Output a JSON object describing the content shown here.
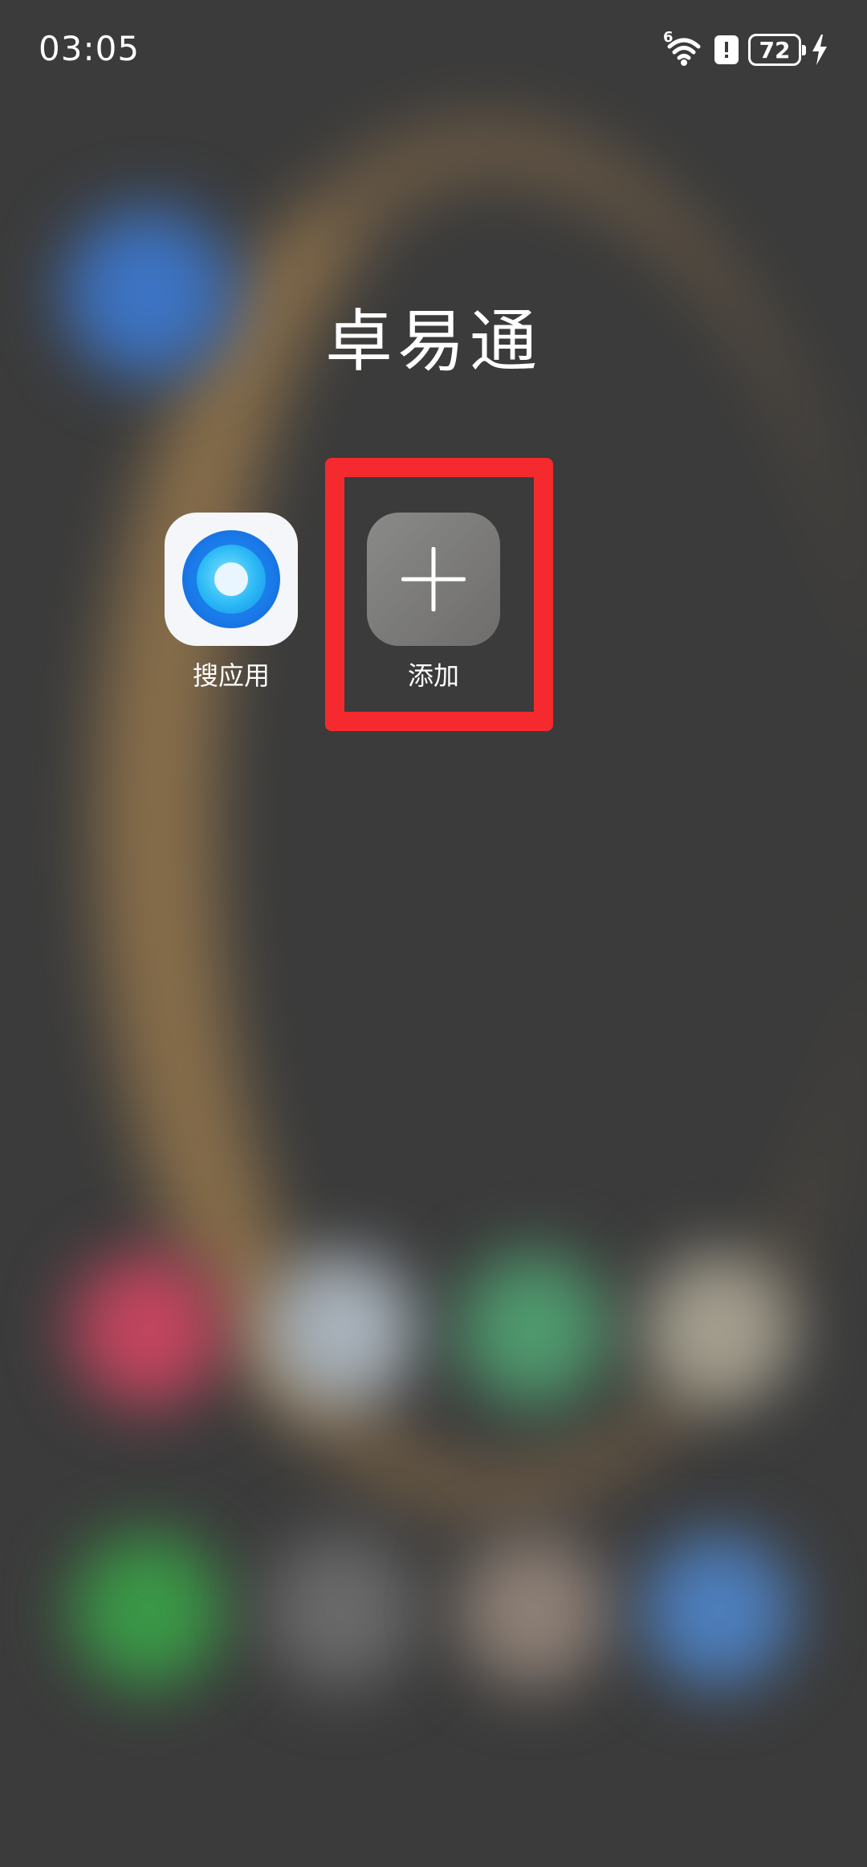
{
  "status_bar": {
    "time": "03:05",
    "network_label": "6",
    "battery_level": "72"
  },
  "folder": {
    "title": "卓易通",
    "apps": [
      {
        "label": "搜应用",
        "icon": "search-app-icon"
      },
      {
        "label": "添加",
        "icon": "plus-icon"
      }
    ]
  },
  "colors": {
    "highlight": "#f52a2e",
    "search_app_blue": "#1a7ae8",
    "add_tile": "#7a7977"
  }
}
